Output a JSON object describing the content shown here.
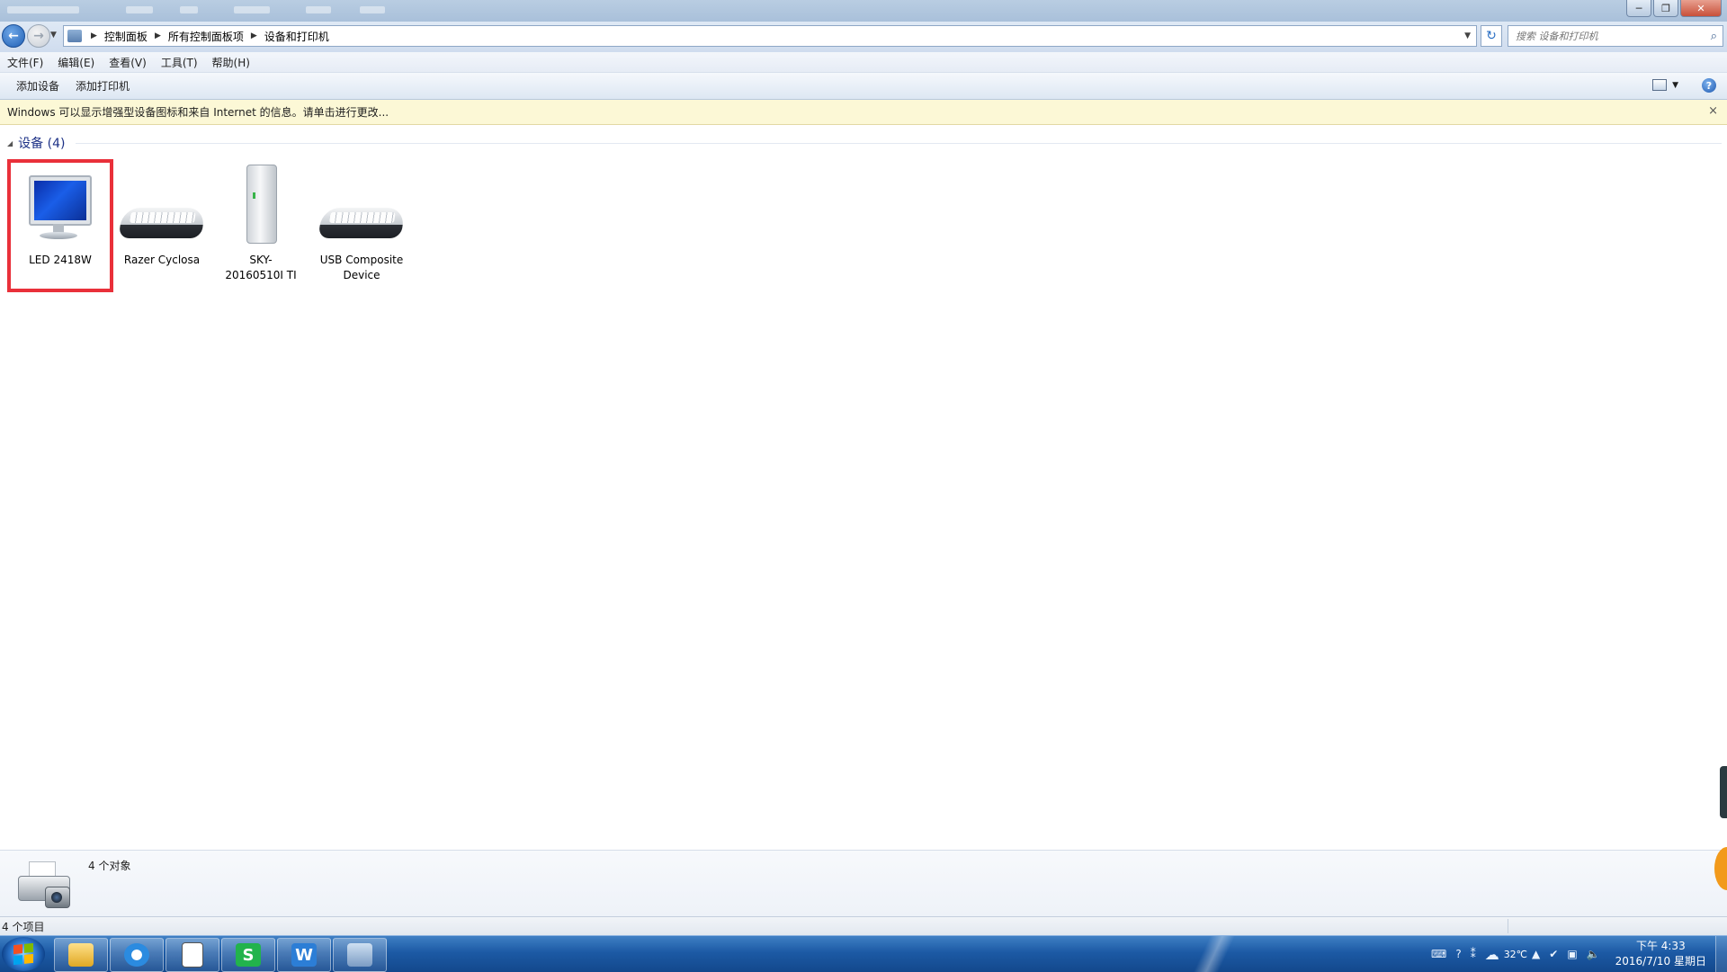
{
  "window": {
    "minimize": "─",
    "maximize": "❐",
    "close": "✕"
  },
  "address": {
    "breadcrumbs": [
      "控制面板",
      "所有控制面板项",
      "设备和打印机"
    ],
    "search_placeholder": "搜索 设备和打印机"
  },
  "menu": [
    "文件(F)",
    "编辑(E)",
    "查看(V)",
    "工具(T)",
    "帮助(H)"
  ],
  "commands": {
    "add_device": "添加设备",
    "add_printer": "添加打印机"
  },
  "infobar": {
    "message": "Windows 可以显示增强型设备图标和来自 Internet 的信息。请单击进行更改...",
    "close": "×"
  },
  "devices_group": {
    "title": "设备 (4)",
    "items": [
      {
        "label": "LED 2418W",
        "icon": "monitor-icon",
        "selected": true
      },
      {
        "label": "Razer Cyclosa",
        "icon": "keyboard-icon",
        "selected": false
      },
      {
        "label": "SKY-20160510I TI",
        "icon": "computer-tower-icon",
        "selected": false
      },
      {
        "label": "USB Composite Device",
        "icon": "keyboard-icon",
        "selected": false
      }
    ]
  },
  "details": {
    "count": "4 个对象"
  },
  "status": {
    "items": "4 个项目"
  },
  "taskbar": {
    "apps": [
      "file-explorer",
      "browser",
      "notepad",
      "wps-spreadsheet",
      "wps-writer",
      "control-panel"
    ],
    "weather": "32℃",
    "time": "下午 4:33",
    "date": "2016/7/10 星期日"
  },
  "colors": {
    "selection_outline": "#e9303a",
    "taskbar": "#1c5aa5",
    "infobar_bg": "#fcf8d6",
    "group_title": "#1e3287"
  }
}
